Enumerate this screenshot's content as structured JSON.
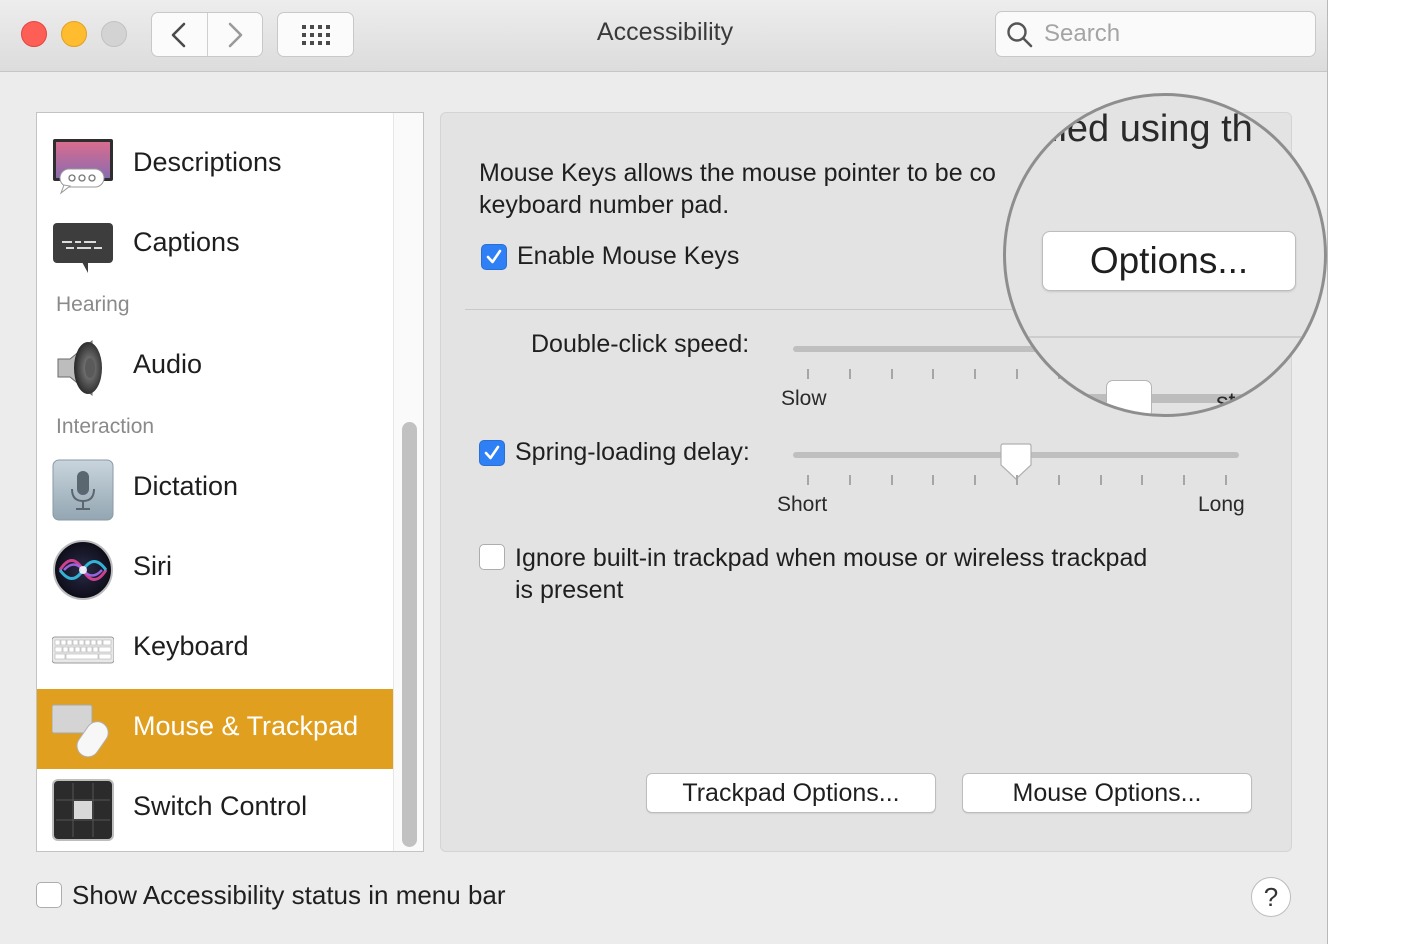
{
  "window": {
    "title": "Accessibility"
  },
  "toolbar": {
    "back_icon": "chevron-left-icon",
    "forward_icon": "chevron-right-icon",
    "grid_icon": "grid-icon"
  },
  "search": {
    "placeholder": "Search",
    "value": ""
  },
  "sidebar": {
    "items": [
      {
        "label": "Descriptions",
        "icon": "descriptions-icon"
      },
      {
        "label": "Captions",
        "icon": "captions-icon"
      },
      {
        "label": "Audio",
        "icon": "speaker-icon"
      },
      {
        "label": "Dictation",
        "icon": "microphone-icon"
      },
      {
        "label": "Siri",
        "icon": "siri-icon"
      },
      {
        "label": "Keyboard",
        "icon": "keyboard-icon"
      },
      {
        "label": "Mouse & Trackpad",
        "icon": "mouse-trackpad-icon",
        "selected": true
      },
      {
        "label": "Switch Control",
        "icon": "switch-control-icon"
      }
    ],
    "sections": {
      "hearing": "Hearing",
      "interaction": "Interaction"
    },
    "selected_color": "#e19f1f"
  },
  "panel": {
    "description_line1": "Mouse Keys allows the mouse pointer to be co",
    "description_line2": "keyboard number pad.",
    "enable_mouse_keys": {
      "label": "Enable Mouse Keys",
      "checked": true
    },
    "double_click": {
      "label": "Double-click speed:",
      "min_label": "Slow",
      "max_label": "Fast",
      "value_fraction": 0.75
    },
    "spring_loading": {
      "label": "Spring-loading delay:",
      "checked": true,
      "min_label": "Short",
      "max_label": "Long",
      "value_fraction": 0.5
    },
    "ignore_trackpad": {
      "label_line1": "Ignore built-in trackpad when mouse or wireless trackpad",
      "label_line2": "is present",
      "checked": false
    },
    "trackpad_options_label": "Trackpad Options...",
    "mouse_options_label": "Mouse Options..."
  },
  "magnifier": {
    "text": "lled using th",
    "options_label": "Options...",
    "slider_tail": "st"
  },
  "footer": {
    "show_status_label": "Show Accessibility status in menu bar",
    "show_status_checked": false,
    "help_label": "?"
  },
  "colors": {
    "checkbox_on": "#2f7ff5",
    "traffic_close": "#fd5f57",
    "traffic_min": "#febc2e"
  }
}
